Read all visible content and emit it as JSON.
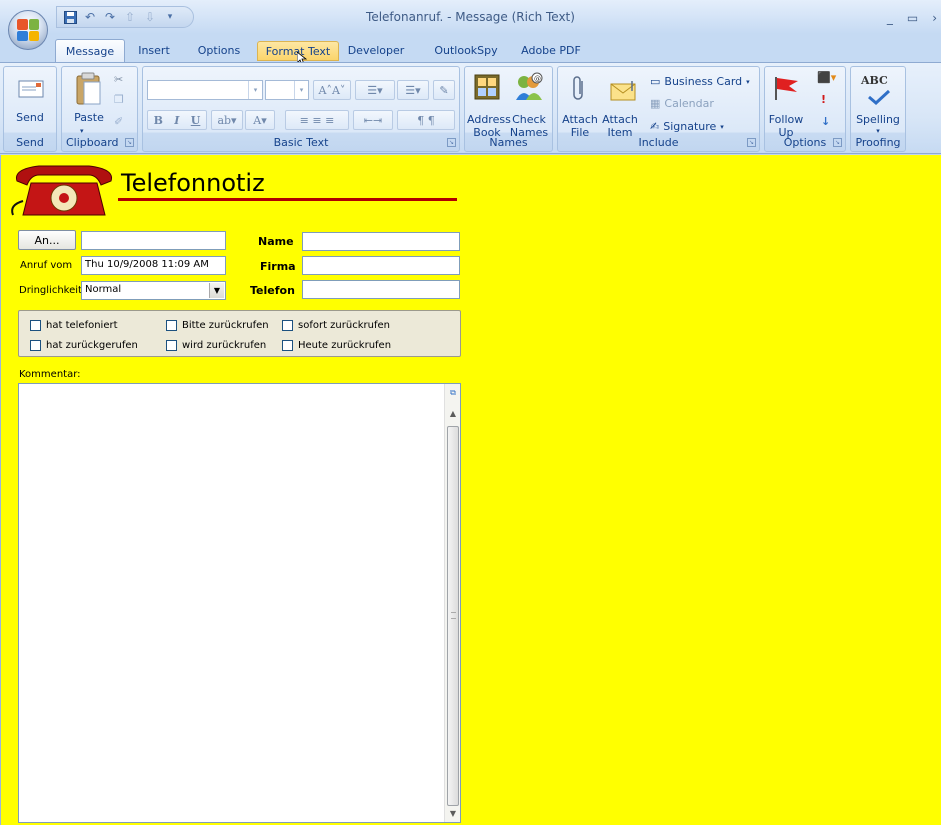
{
  "window": {
    "title": "Telefonanruf. - Message (Rich Text)",
    "minimize": "_",
    "maximize": "▭",
    "close": "›"
  },
  "tabs": [
    {
      "label": "Message"
    },
    {
      "label": "Insert"
    },
    {
      "label": "Options"
    },
    {
      "label": "Format Text"
    },
    {
      "label": "Developer"
    },
    {
      "label": "OutlookSpy"
    },
    {
      "label": "Adobe PDF"
    }
  ],
  "ribbon": {
    "send": {
      "button": "Send",
      "group": "Send"
    },
    "clipboard": {
      "paste": "Paste",
      "group": "Clipboard"
    },
    "basic_text": {
      "group": "Basic Text",
      "bold": "B",
      "italic": "I",
      "underline": "U",
      "font_color": "A"
    },
    "names": {
      "address_book": "Address\nBook",
      "check_names": "Check\nNames",
      "group": "Names"
    },
    "include": {
      "attach_file": "Attach\nFile",
      "attach_item": "Attach\nItem",
      "business_card": "Business Card",
      "calendar": "Calendar",
      "signature": "Signature",
      "group": "Include"
    },
    "options": {
      "follow_up": "Follow\nUp",
      "group": "Options"
    },
    "proofing": {
      "spelling": "Spelling",
      "abc": "ABC",
      "group": "Proofing"
    }
  },
  "form": {
    "title": "Telefonnotiz",
    "an_button": "An...",
    "an_value": "",
    "anruf_vom_label": "Anruf vom",
    "anruf_vom_value": "Thu 10/9/2008 11:09 AM",
    "dringlichkeit_label": "Dringlichkeit",
    "dringlichkeit_value": "Normal",
    "name_label": "Name",
    "name_value": "",
    "firma_label": "Firma",
    "firma_value": "",
    "telefon_label": "Telefon",
    "telefon_value": "",
    "checkboxes": [
      {
        "label": "hat telefoniert",
        "checked": false
      },
      {
        "label": "Bitte zurückrufen",
        "checked": false
      },
      {
        "label": "sofort zurückrufen",
        "checked": false
      },
      {
        "label": "hat zurückgerufen",
        "checked": false
      },
      {
        "label": "wird zurückrufen",
        "checked": false
      },
      {
        "label": "Heute zurückrufen",
        "checked": false
      }
    ],
    "kommentar_label": "Kommentar:",
    "kommentar_value": ""
  },
  "colors": {
    "form_background": "#ffff00",
    "title_underline": "#b00000",
    "ribbon_text": "#15428b"
  }
}
